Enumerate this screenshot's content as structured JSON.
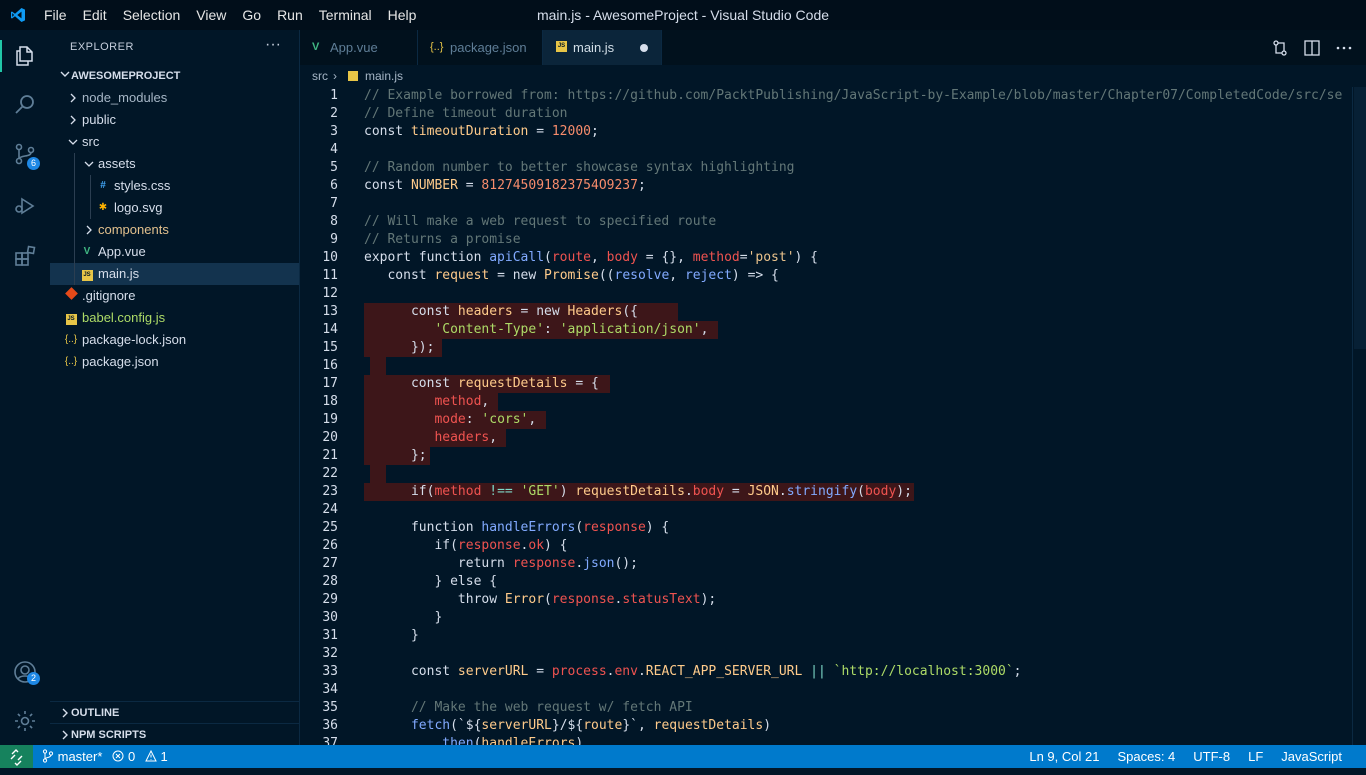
{
  "window": {
    "menu": [
      "File",
      "Edit",
      "Selection",
      "View",
      "Go",
      "Run",
      "Terminal",
      "Help"
    ],
    "title": "main.js - AwesomeProject - Visual Studio Code"
  },
  "activity_bar": {
    "icons": [
      "files-icon",
      "search-icon",
      "source-control-icon",
      "run-debug-icon",
      "extensions-icon",
      "account-icon",
      "settings-gear-icon"
    ],
    "source_control_badge": "6",
    "account_badge": "2"
  },
  "explorer": {
    "title": "EXPLORER",
    "more": "···",
    "project": "AWESOMEPROJECT",
    "tree": [
      {
        "label": "node_modules",
        "type": "folder",
        "expanded": false,
        "color": "#a6b6c6"
      },
      {
        "label": "public",
        "type": "folder",
        "expanded": false,
        "color": "#d6deeb"
      },
      {
        "label": "src",
        "type": "folder",
        "expanded": true,
        "color": "#d6deeb"
      },
      {
        "label": "assets",
        "type": "folder",
        "expanded": true,
        "color": "#d6deeb"
      },
      {
        "label": "styles.css",
        "type": "css",
        "color": "#d6deeb"
      },
      {
        "label": "logo.svg",
        "type": "svg",
        "color": "#d6deeb"
      },
      {
        "label": "components",
        "type": "folder",
        "expanded": false,
        "color": "#e2c08d"
      },
      {
        "label": "App.vue",
        "type": "vue",
        "color": "#d6deeb"
      },
      {
        "label": "main.js",
        "type": "js",
        "color": "#d6deeb",
        "selected": true
      },
      {
        "label": ".gitignore",
        "type": "git",
        "color": "#d6deeb"
      },
      {
        "label": "babel.config.js",
        "type": "js",
        "color": "#addb67"
      },
      {
        "label": "package-lock.json",
        "type": "json",
        "color": "#d6deeb"
      },
      {
        "label": "package.json",
        "type": "json",
        "color": "#d6deeb"
      }
    ],
    "outline": "OUTLINE",
    "npm_scripts": "NPM SCRIPTS"
  },
  "tabs": [
    {
      "label": "App.vue",
      "icon": "V",
      "active": false
    },
    {
      "label": "package.json",
      "icon": "{..}",
      "active": false
    },
    {
      "label": "main.js",
      "icon": "JS",
      "active": true,
      "dirty": true
    }
  ],
  "breadcrumb": {
    "folder": "src",
    "file": "main.js",
    "separator": "›"
  },
  "editor": {
    "lines": [
      {
        "n": "1",
        "tokens": [
          [
            "c-comment",
            "// Example borrowed from: https://github.com/PacktPublishing/JavaScript-by-Example/blob/master/Chapter07/CompletedCode/src/se"
          ]
        ]
      },
      {
        "n": "2",
        "tokens": [
          [
            "c-comment",
            "// Define timeout duration"
          ]
        ]
      },
      {
        "n": "3",
        "tokens": [
          [
            "c-plain",
            "const "
          ],
          [
            "c-const",
            "timeoutDuration"
          ],
          [
            "c-plain",
            " = "
          ],
          [
            "c-num",
            "12000"
          ],
          [
            "c-plain",
            ";"
          ]
        ]
      },
      {
        "n": "4",
        "tokens": []
      },
      {
        "n": "5",
        "tokens": [
          [
            "c-comment",
            "// Random number to better showcase syntax highlighting"
          ]
        ]
      },
      {
        "n": "6",
        "tokens": [
          [
            "c-plain",
            "const "
          ],
          [
            "c-const",
            "NUMBER"
          ],
          [
            "c-plain",
            " = "
          ],
          [
            "c-num",
            "812745091823754O9237"
          ],
          [
            "c-plain",
            ";"
          ]
        ]
      },
      {
        "n": "7",
        "tokens": []
      },
      {
        "n": "8",
        "tokens": [
          [
            "c-comment",
            "// Will make a web request to specified route"
          ]
        ]
      },
      {
        "n": "9",
        "tokens": [
          [
            "c-comment",
            "// Returns a promise"
          ]
        ]
      },
      {
        "n": "10",
        "tokens": [
          [
            "c-plain",
            "export function "
          ],
          [
            "c-fn",
            "apiCall"
          ],
          [
            "c-plain",
            "("
          ],
          [
            "c-red",
            "route"
          ],
          [
            "c-plain",
            ", "
          ],
          [
            "c-red",
            "body"
          ],
          [
            "c-plain",
            " = {}, "
          ],
          [
            "c-red",
            "method"
          ],
          [
            "c-plain",
            "="
          ],
          [
            "c-str",
            "'post'"
          ],
          [
            "c-plain",
            ") {"
          ]
        ]
      },
      {
        "n": "11",
        "tokens": [
          [
            "c-plain",
            "   const "
          ],
          [
            "c-const",
            "request"
          ],
          [
            "c-plain",
            " = new "
          ],
          [
            "c-const",
            "Promise"
          ],
          [
            "c-plain",
            "(("
          ],
          [
            "c-var",
            "resolve"
          ],
          [
            "c-plain",
            ", "
          ],
          [
            "c-var",
            "reject"
          ],
          [
            "c-plain",
            ") => {"
          ]
        ]
      },
      {
        "n": "12",
        "tokens": []
      },
      {
        "n": "13",
        "tokens": [
          [
            "c-plain",
            "      const "
          ],
          [
            "c-const",
            "headers"
          ],
          [
            "c-plain",
            " = new "
          ],
          [
            "c-const",
            "Headers"
          ],
          [
            "c-plain",
            "({"
          ]
        ]
      },
      {
        "n": "14",
        "tokens": [
          [
            "c-plain",
            "         "
          ],
          [
            "c-prop",
            "'Content-Type'"
          ],
          [
            "c-plain",
            ": "
          ],
          [
            "c-prop",
            "'application/json'"
          ],
          [
            "c-plain",
            ","
          ]
        ]
      },
      {
        "n": "15",
        "tokens": [
          [
            "c-plain",
            "      });"
          ]
        ]
      },
      {
        "n": "16",
        "tokens": []
      },
      {
        "n": "17",
        "tokens": [
          [
            "c-plain",
            "      const "
          ],
          [
            "c-const",
            "requestDetails"
          ],
          [
            "c-plain",
            " = {"
          ]
        ]
      },
      {
        "n": "18",
        "tokens": [
          [
            "c-plain",
            "         "
          ],
          [
            "c-red",
            "method"
          ],
          [
            "c-plain",
            ","
          ]
        ]
      },
      {
        "n": "19",
        "tokens": [
          [
            "c-plain",
            "         "
          ],
          [
            "c-red",
            "mode"
          ],
          [
            "c-plain",
            ": "
          ],
          [
            "c-prop",
            "'cors'"
          ],
          [
            "c-plain",
            ","
          ]
        ]
      },
      {
        "n": "20",
        "tokens": [
          [
            "c-plain",
            "         "
          ],
          [
            "c-red",
            "headers"
          ],
          [
            "c-plain",
            ","
          ]
        ]
      },
      {
        "n": "21",
        "tokens": [
          [
            "c-plain",
            "      };"
          ]
        ]
      },
      {
        "n": "22",
        "tokens": []
      },
      {
        "n": "23",
        "tokens": [
          [
            "c-plain",
            "      if("
          ],
          [
            "c-red",
            "method"
          ],
          [
            "c-plain",
            " "
          ],
          [
            "c-op",
            "!=="
          ],
          [
            "c-plain",
            " "
          ],
          [
            "c-prop",
            "'GET'"
          ],
          [
            "c-plain",
            ") "
          ],
          [
            "c-const",
            "requestDetails"
          ],
          [
            "c-plain",
            "."
          ],
          [
            "c-red",
            "body"
          ],
          [
            "c-plain",
            " = "
          ],
          [
            "c-const",
            "JSON"
          ],
          [
            "c-plain",
            "."
          ],
          [
            "c-fn",
            "stringify"
          ],
          [
            "c-plain",
            "("
          ],
          [
            "c-red",
            "body"
          ],
          [
            "c-plain",
            ");"
          ]
        ]
      },
      {
        "n": "24",
        "tokens": []
      },
      {
        "n": "25",
        "tokens": [
          [
            "c-plain",
            "      function "
          ],
          [
            "c-fn",
            "handleErrors"
          ],
          [
            "c-plain",
            "("
          ],
          [
            "c-red",
            "response"
          ],
          [
            "c-plain",
            ") {"
          ]
        ]
      },
      {
        "n": "26",
        "tokens": [
          [
            "c-plain",
            "         if("
          ],
          [
            "c-red",
            "response"
          ],
          [
            "c-plain",
            "."
          ],
          [
            "c-red",
            "ok"
          ],
          [
            "c-plain",
            ") {"
          ]
        ]
      },
      {
        "n": "27",
        "tokens": [
          [
            "c-plain",
            "            return "
          ],
          [
            "c-red",
            "response"
          ],
          [
            "c-plain",
            "."
          ],
          [
            "c-fn",
            "json"
          ],
          [
            "c-plain",
            "();"
          ]
        ]
      },
      {
        "n": "28",
        "tokens": [
          [
            "c-plain",
            "         } else {"
          ]
        ]
      },
      {
        "n": "29",
        "tokens": [
          [
            "c-plain",
            "            throw "
          ],
          [
            "c-const",
            "Error"
          ],
          [
            "c-plain",
            "("
          ],
          [
            "c-red",
            "response"
          ],
          [
            "c-plain",
            "."
          ],
          [
            "c-red",
            "statusText"
          ],
          [
            "c-plain",
            ");"
          ]
        ]
      },
      {
        "n": "30",
        "tokens": [
          [
            "c-plain",
            "         }"
          ]
        ]
      },
      {
        "n": "31",
        "tokens": [
          [
            "c-plain",
            "      }"
          ]
        ]
      },
      {
        "n": "32",
        "tokens": []
      },
      {
        "n": "33",
        "tokens": [
          [
            "c-plain",
            "      const "
          ],
          [
            "c-const",
            "serverURL"
          ],
          [
            "c-plain",
            " = "
          ],
          [
            "c-red",
            "process"
          ],
          [
            "c-plain",
            "."
          ],
          [
            "c-red",
            "env"
          ],
          [
            "c-plain",
            "."
          ],
          [
            "c-const",
            "REACT_APP_SERVER_URL"
          ],
          [
            "c-plain",
            " "
          ],
          [
            "c-op",
            "||"
          ],
          [
            "c-plain",
            " "
          ],
          [
            "c-prop",
            "`http://localhost:3000`"
          ],
          [
            "c-plain",
            ";"
          ]
        ]
      },
      {
        "n": "34",
        "tokens": []
      },
      {
        "n": "35",
        "tokens": [
          [
            "c-comment",
            "      // Make the web request w/ fetch API"
          ]
        ]
      },
      {
        "n": "36",
        "tokens": [
          [
            "c-plain",
            "      "
          ],
          [
            "c-fn",
            "fetch"
          ],
          [
            "c-plain",
            "(`${"
          ],
          [
            "c-const",
            "serverURL"
          ],
          [
            "c-plain",
            "}/${"
          ],
          [
            "c-const",
            "route"
          ],
          [
            "c-plain",
            "}`, "
          ],
          [
            "c-const",
            "requestDetails"
          ],
          [
            "c-plain",
            ")"
          ]
        ]
      },
      {
        "n": "37",
        "tokens": [
          [
            "c-plain",
            "         ."
          ],
          [
            "c-fn",
            "then"
          ],
          [
            "c-plain",
            "("
          ],
          [
            "c-const",
            "handleErrors"
          ],
          [
            "c-plain",
            ")"
          ]
        ]
      }
    ]
  },
  "statusbar": {
    "branch": "master*",
    "errors": "0",
    "warnings": "1",
    "position": "Ln 9, Col 21",
    "spaces": "Spaces: 4",
    "encoding": "UTF-8",
    "eol": "LF",
    "language": "JavaScript"
  },
  "colors": {
    "accent": "#21c7a8",
    "status_bar": "#007acc",
    "editor_bg": "#011627"
  }
}
